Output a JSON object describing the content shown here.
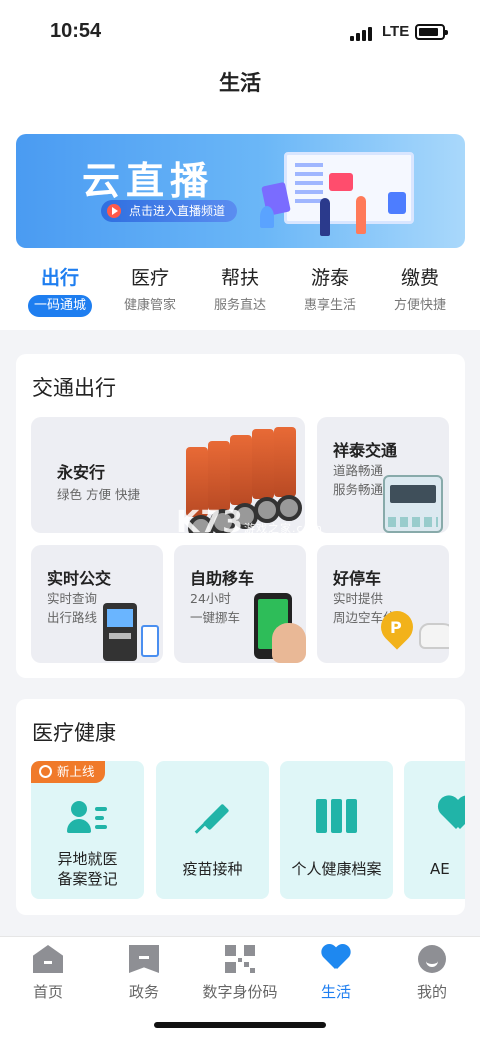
{
  "status_bar": {
    "time": "10:54",
    "network": "LTE"
  },
  "page": {
    "title": "生活"
  },
  "banner": {
    "title": "云直播",
    "button_label": "点击进入直播频道"
  },
  "tabs": [
    {
      "title": "出行",
      "subtitle": "一码通城",
      "active": true
    },
    {
      "title": "医疗",
      "subtitle": "健康管家",
      "active": false
    },
    {
      "title": "帮扶",
      "subtitle": "服务直达",
      "active": false
    },
    {
      "title": "游泰",
      "subtitle": "惠享生活",
      "active": false
    },
    {
      "title": "缴费",
      "subtitle": "方便快捷",
      "active": false
    }
  ],
  "traffic": {
    "title": "交通出行",
    "cards": [
      {
        "title": "永安行",
        "desc": "绿色 方便 快捷"
      },
      {
        "title": "祥泰交通",
        "desc_line1": "道路畅通",
        "desc_line2": "服务畅通"
      },
      {
        "title": "实时公交",
        "desc_line1": "实时查询",
        "desc_line2": "出行路线"
      },
      {
        "title": "自助移车",
        "desc_line1": "24小时",
        "desc_line2": "一键挪车"
      },
      {
        "title": "好停车",
        "desc_line1": "实时提供",
        "desc_line2": "周边空车位"
      }
    ]
  },
  "watermark": {
    "text": "K73",
    "sub": "游戏之家",
    "domain": ".com"
  },
  "health": {
    "title": "医疗健康",
    "new_badge": "新上线",
    "cards": [
      {
        "line1": "异地就医",
        "line2": "备案登记"
      },
      {
        "label": "疫苗接种"
      },
      {
        "label": "个人健康档案"
      },
      {
        "label": "AE"
      }
    ]
  },
  "bottom_nav": [
    {
      "label": "首页",
      "icon": "home-icon",
      "active": false
    },
    {
      "label": "政务",
      "icon": "government-icon",
      "active": false
    },
    {
      "label": "数字身份码",
      "icon": "qr-code-icon",
      "active": false
    },
    {
      "label": "生活",
      "icon": "heart-icon",
      "active": true
    },
    {
      "label": "我的",
      "icon": "profile-icon",
      "active": false
    }
  ],
  "colors": {
    "accent": "#1e7ef0",
    "teal": "#21b4a8",
    "badge": "#f07a2a"
  }
}
